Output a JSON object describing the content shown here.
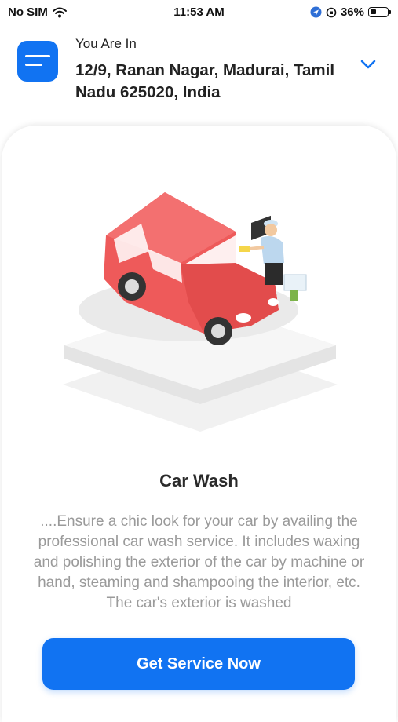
{
  "status_bar": {
    "carrier": "No SIM",
    "time": "11:53 AM",
    "battery": "36%",
    "battery_level": 0.36,
    "icons": [
      "wifi-icon",
      "location-icon",
      "rotation-lock-icon",
      "battery-icon"
    ]
  },
  "header": {
    "menu_icon": "menu-icon",
    "location_label": "You Are In",
    "address": "12/9, Ranan Nagar, Madurai, Tamil Nadu 625020, India",
    "dropdown_icon": "chevron-down-icon"
  },
  "service": {
    "title": "Car Wash",
    "description": "....Ensure a chic look for your car by availing the professional car wash service. It includes waxing and polishing the exterior of the car by machine or hand, steaming and shampooing the interior, etc. The car's exterior is washed",
    "cta_label": "Get Service Now"
  },
  "colors": {
    "accent": "#1173f2",
    "car": "#ee5a5a",
    "text_muted": "#9a9a9a"
  }
}
